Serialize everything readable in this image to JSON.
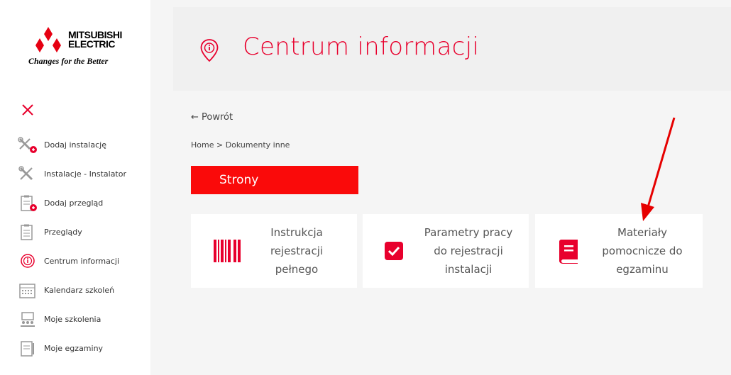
{
  "logo": {
    "brand_line1": "MITSUBISHI",
    "brand_line2": "ELECTRIC",
    "tagline": "Changes for the Better"
  },
  "sidebar": {
    "close_icon": "close-icon",
    "items": [
      {
        "label": "Dodaj instalację",
        "icon": "tools-add-icon"
      },
      {
        "label": "Instalacje - Instalator",
        "icon": "tools-icon"
      },
      {
        "label": "Dodaj przegląd",
        "icon": "clipboard-add-icon"
      },
      {
        "label": "Przeglądy",
        "icon": "clipboard-icon"
      },
      {
        "label": "Centrum informacji",
        "icon": "info-pin-icon"
      },
      {
        "label": "Kalendarz szkoleń",
        "icon": "calendar-icon"
      },
      {
        "label": "Moje szkolenia",
        "icon": "presentation-icon"
      },
      {
        "label": "Moje egzaminy",
        "icon": "exam-icon"
      }
    ]
  },
  "header": {
    "title": "Centrum informacji",
    "icon": "info-pin-icon"
  },
  "back_link": "← Powrót",
  "breadcrumb": {
    "home": "Home",
    "separator": " > ",
    "current": "Dokumenty inne"
  },
  "section_title": "Strony",
  "cards": [
    {
      "lines": [
        "Instrukcja",
        "rejestracji",
        "pełnego"
      ],
      "icon": "barcode-icon"
    },
    {
      "lines": [
        "Parametry pracy",
        "do rejestracji",
        "instalacji"
      ],
      "icon": "checkbox-icon"
    },
    {
      "lines": [
        "Materiały",
        "pomocnicze do",
        "egzaminu"
      ],
      "icon": "book-icon"
    }
  ],
  "colors": {
    "accent": "#e8002d",
    "section_bg": "#fa0a0a",
    "arrow": "#e60000"
  }
}
